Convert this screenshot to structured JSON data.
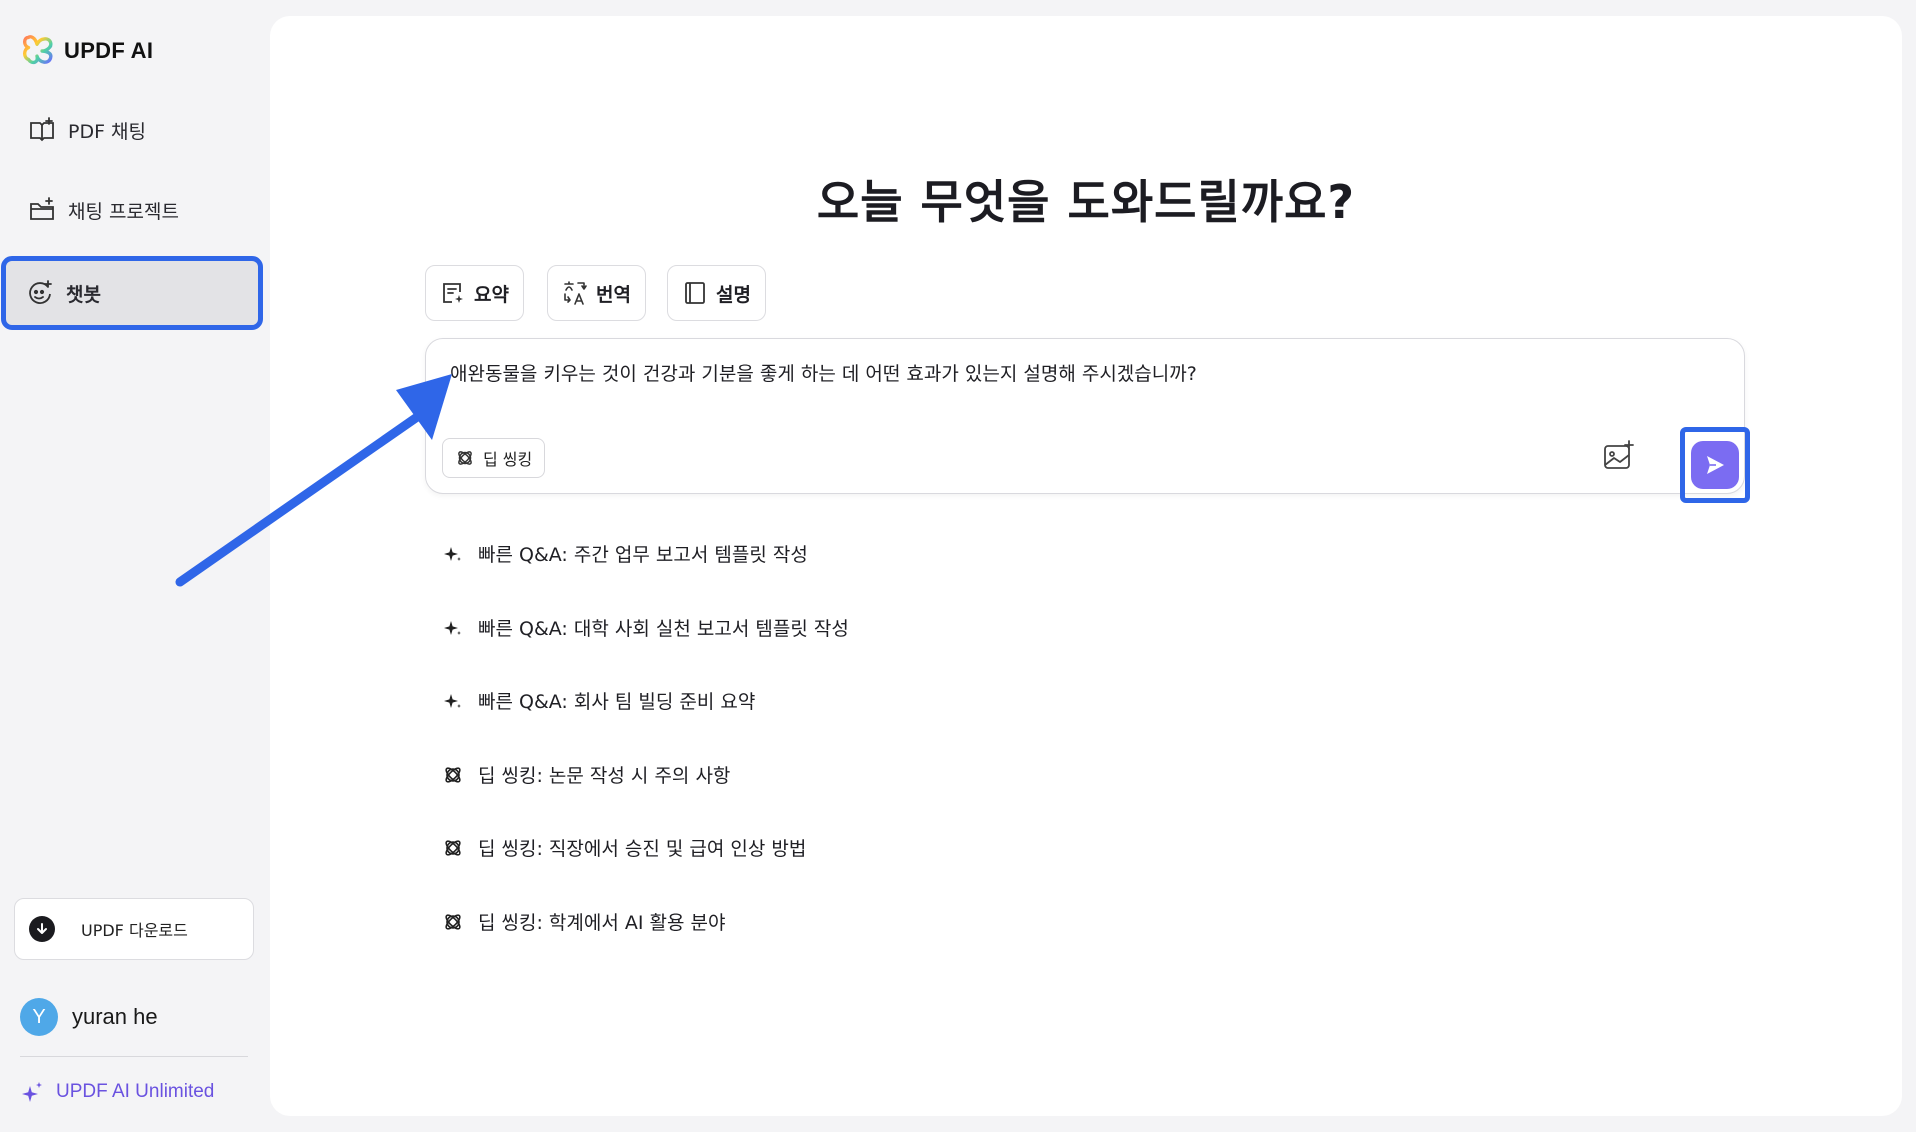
{
  "app": {
    "name": "UPDF AI"
  },
  "sidebar": {
    "items": [
      {
        "label": "PDF 채팅",
        "icon": "book-icon"
      },
      {
        "label": "채팅 프로젝트",
        "icon": "folder-plus-icon"
      },
      {
        "label": "챗봇",
        "icon": "bot-face-icon",
        "active": true
      }
    ],
    "download_label": "UPDF 다운로드",
    "user": {
      "initial": "Y",
      "name": "yuran he"
    },
    "unlimited_label": "UPDF AI Unlimited"
  },
  "main": {
    "title": "오늘 무엇을 도와드릴까요?",
    "chips": [
      {
        "label": "요약",
        "icon": "summary-icon"
      },
      {
        "label": "번역",
        "icon": "translate-icon"
      },
      {
        "label": "설명",
        "icon": "book-open-icon"
      }
    ],
    "input": {
      "value": "애완동물을 키우는 것이 건강과 기분을 좋게 하는 데 어떤 효과가 있는지 설명해 주시겠습니까?",
      "deep_label": "딥 씽킹"
    },
    "suggestions": [
      {
        "label": "빠른 Q&A: 주간 업무 보고서 템플릿 작성",
        "icon": "sparkle-icon"
      },
      {
        "label": "빠른 Q&A: 대학 사회 실천 보고서 템플릿 작성",
        "icon": "sparkle-icon"
      },
      {
        "label": "빠른 Q&A: 회사 팀 빌딩 준비 요약",
        "icon": "sparkle-icon"
      },
      {
        "label": "딥 씽킹: 논문 작성 시 주의 사항",
        "icon": "atom-icon"
      },
      {
        "label": "딥 씽킹: 직장에서 승진 및 급여 인상 방법",
        "icon": "atom-icon"
      },
      {
        "label": "딥 씽킹: 학계에서 AI 활용 분야",
        "icon": "atom-icon"
      }
    ]
  },
  "colors": {
    "accent": "#7b6cf2",
    "highlight": "#2f66e8",
    "avatar": "#4fa8e8",
    "unlimited": "#6a52e0"
  }
}
